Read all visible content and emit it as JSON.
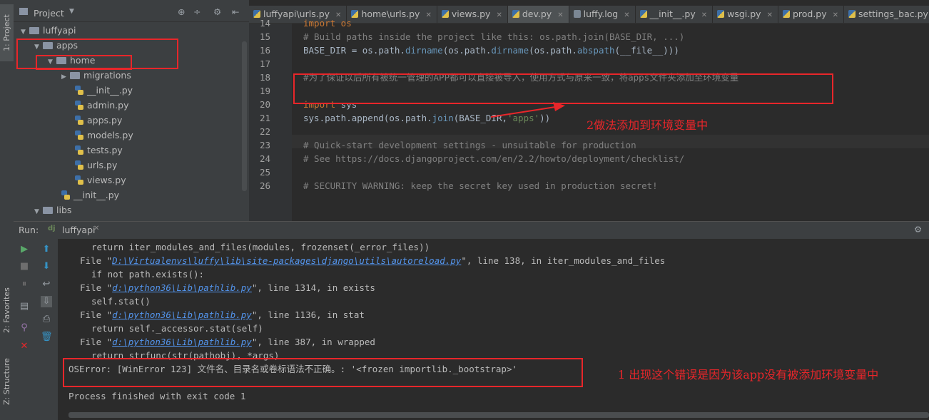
{
  "left_strip": {
    "project_tab": "1: Project",
    "favorites_tab": "2: Favorites",
    "structure_tab": "Z: Structure"
  },
  "project": {
    "title": "Project",
    "tree": [
      {
        "label": "luffyapi",
        "kind": "folder",
        "depth": 0,
        "open": true
      },
      {
        "label": "apps",
        "kind": "folder",
        "depth": 1,
        "open": true
      },
      {
        "label": "home",
        "kind": "folder",
        "depth": 2,
        "open": true
      },
      {
        "label": "migrations",
        "kind": "folder",
        "depth": 3,
        "open": false
      },
      {
        "label": "__init__.py",
        "kind": "py",
        "depth": 4
      },
      {
        "label": "admin.py",
        "kind": "py",
        "depth": 4
      },
      {
        "label": "apps.py",
        "kind": "py",
        "depth": 4
      },
      {
        "label": "models.py",
        "kind": "py",
        "depth": 4
      },
      {
        "label": "tests.py",
        "kind": "py",
        "depth": 4
      },
      {
        "label": "urls.py",
        "kind": "py",
        "depth": 4
      },
      {
        "label": "views.py",
        "kind": "py",
        "depth": 4
      },
      {
        "label": "__init__.py",
        "kind": "py",
        "depth": 3
      },
      {
        "label": "libs",
        "kind": "folder",
        "depth": 1,
        "open": true
      }
    ]
  },
  "tabs": [
    {
      "label": "luffyapi\\urls.py",
      "icon": "py",
      "active": false
    },
    {
      "label": "home\\urls.py",
      "icon": "py",
      "active": false
    },
    {
      "label": "views.py",
      "icon": "py",
      "active": false
    },
    {
      "label": "dev.py",
      "icon": "py",
      "active": true
    },
    {
      "label": "luffy.log",
      "icon": "log",
      "active": false
    },
    {
      "label": "__init__.py",
      "icon": "py",
      "active": false
    },
    {
      "label": "wsgi.py",
      "icon": "py",
      "active": false
    },
    {
      "label": "prod.py",
      "icon": "py",
      "active": false
    },
    {
      "label": "settings_bac.py",
      "icon": "py",
      "active": false
    }
  ],
  "editor": {
    "lines": [
      {
        "n": "14",
        "segments": [
          {
            "t": "import os",
            "c": "kw"
          }
        ]
      },
      {
        "n": "15",
        "segments": [
          {
            "t": "# Build paths inside the project like this: os.path.join(BASE_DIR, ...)",
            "c": "cm"
          }
        ]
      },
      {
        "n": "16",
        "segments": [
          {
            "t": "BASE_DIR = os.path.",
            "c": ""
          },
          {
            "t": "dirname",
            "c": "fn"
          },
          {
            "t": "(os.path.",
            "c": ""
          },
          {
            "t": "dirname",
            "c": "fn"
          },
          {
            "t": "(os.path.",
            "c": ""
          },
          {
            "t": "abspath",
            "c": "fn"
          },
          {
            "t": "(__file__)))",
            "c": ""
          }
        ]
      },
      {
        "n": "17",
        "segments": []
      },
      {
        "n": "18",
        "segments": [
          {
            "t": "#为了保证以后所有被统一管理的APP都可以直接被导入，使用方式与原来一致，将apps文件夹添加至环境变量",
            "c": "cm"
          }
        ]
      },
      {
        "n": "19",
        "segments": []
      },
      {
        "n": "20",
        "segments": [
          {
            "t": "import",
            "c": "kw"
          },
          {
            "t": " sys",
            "c": ""
          }
        ]
      },
      {
        "n": "21",
        "segments": [
          {
            "t": "sys.path.append(os.path.",
            "c": ""
          },
          {
            "t": "join",
            "c": "fn"
          },
          {
            "t": "(BASE_DIR,",
            "c": ""
          },
          {
            "t": "'apps'",
            "c": "st"
          },
          {
            "t": "))",
            "c": ""
          }
        ]
      },
      {
        "n": "22",
        "segments": []
      },
      {
        "n": "23",
        "segments": [
          {
            "t": "# Quick-start development settings - unsuitable for production",
            "c": "cm"
          }
        ]
      },
      {
        "n": "24",
        "segments": [
          {
            "t": "# See https://docs.djangoproject.com/en/2.2/howto/deployment/checklist/",
            "c": "cm"
          }
        ]
      },
      {
        "n": "25",
        "segments": []
      },
      {
        "n": "26",
        "segments": [
          {
            "t": "# SECURITY WARNING: keep the secret key used in production secret!",
            "c": "cm"
          }
        ]
      }
    ]
  },
  "annotations": {
    "fix_note": "2做法添加到环境变量中",
    "error_note": "1 出现这个错误是因为该app没有被添加环境变量中"
  },
  "run": {
    "label": "Run:",
    "config": "luffyapi"
  },
  "console": {
    "lines": [
      {
        "indent": 2,
        "segments": [
          {
            "t": "return iter_modules_and_files(modules, frozenset(_error_files))",
            "c": ""
          }
        ]
      },
      {
        "indent": 1,
        "segments": [
          {
            "t": "File \"",
            "c": ""
          },
          {
            "t": "D:\\Virtualenvs\\luffy\\lib\\site-packages\\django\\utils\\autoreload.py",
            "c": "link"
          },
          {
            "t": "\", line 138, in iter_modules_and_files",
            "c": ""
          }
        ]
      },
      {
        "indent": 2,
        "segments": [
          {
            "t": "if not path.exists():",
            "c": ""
          }
        ]
      },
      {
        "indent": 1,
        "segments": [
          {
            "t": "File \"",
            "c": ""
          },
          {
            "t": "d:\\python36\\Lib\\pathlib.py",
            "c": "link"
          },
          {
            "t": "\", line 1314, in exists",
            "c": ""
          }
        ]
      },
      {
        "indent": 2,
        "segments": [
          {
            "t": "self.stat()",
            "c": ""
          }
        ]
      },
      {
        "indent": 1,
        "segments": [
          {
            "t": "File \"",
            "c": ""
          },
          {
            "t": "d:\\python36\\Lib\\pathlib.py",
            "c": "link"
          },
          {
            "t": "\", line 1136, in stat",
            "c": ""
          }
        ]
      },
      {
        "indent": 2,
        "segments": [
          {
            "t": "return self._accessor.stat(self)",
            "c": ""
          }
        ]
      },
      {
        "indent": 1,
        "segments": [
          {
            "t": "File \"",
            "c": ""
          },
          {
            "t": "d:\\python36\\Lib\\pathlib.py",
            "c": "link"
          },
          {
            "t": "\", line 387, in wrapped",
            "c": ""
          }
        ]
      },
      {
        "indent": 2,
        "segments": [
          {
            "t": "return strfunc(str(pathobj), *args)",
            "c": ""
          }
        ]
      },
      {
        "indent": 0,
        "segments": [
          {
            "t": "OSError: [WinError 123] 文件名、目录名或卷标语法不正确。: '<frozen importlib._bootstrap>'",
            "c": ""
          }
        ]
      },
      {
        "indent": 0,
        "segments": []
      },
      {
        "indent": 0,
        "segments": [
          {
            "t": "Process finished with exit code 1",
            "c": ""
          }
        ]
      }
    ]
  },
  "colors": {
    "annotation": "#e8262a",
    "link": "#5394ec",
    "keyword": "#cc7832",
    "comment": "#808080"
  }
}
